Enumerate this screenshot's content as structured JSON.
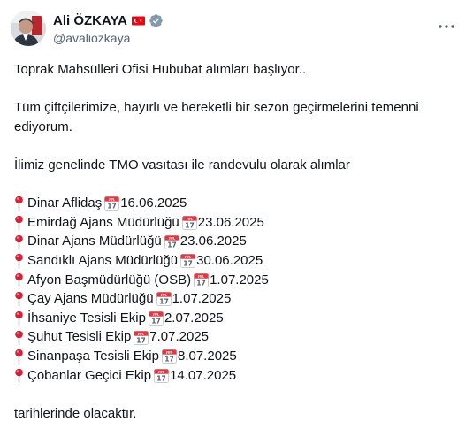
{
  "author": {
    "name": "Ali ÖZKAYA",
    "handle": "@avaliozkaya",
    "flag_icon": "turkey-flag-icon",
    "verified_icon": "verified-badge-icon",
    "verified_color": "#829aab"
  },
  "post": {
    "intro": "Toprak Mahsülleri Ofisi Hububat alımları başlıyor..",
    "wish": "Tüm çiftçilerimize, hayırlı ve bereketli bir sezon geçirmelerini temenni ediyorum.",
    "lead": "İlimiz genelinde TMO vasıtası ile randevulu olarak alımlar",
    "items": [
      {
        "place": "Dinar Aflidaş",
        "date": "16.06.2025"
      },
      {
        "place": "Emirdağ Ajans Müdürlüğü",
        "date": "23.06.2025"
      },
      {
        "place": "Dinar Ajans Müdürlüğü",
        "date": "23.06.2025"
      },
      {
        "place": "Sandıklı Ajans Müdürlüğü",
        "date": "30.06.2025"
      },
      {
        "place": "Afyon Başmüdürlüğü (OSB)",
        "date": "1.07.2025"
      },
      {
        "place": "Çay Ajans Müdürlüğü",
        "date": "1.07.2025"
      },
      {
        "place": "İhsaniye Tesisli Ekip",
        "date": "2.07.2025"
      },
      {
        "place": "Şuhut Tesisli Ekip",
        "date": "7.07.2025"
      },
      {
        "place": "Sinanpaşa Tesisli Ekip",
        "date": "8.07.2025"
      },
      {
        "place": "Çobanlar Geçici Ekip",
        "date": "14.07.2025"
      }
    ],
    "outro": "tarihlerinde olacaktır.",
    "item_icon": "round-pushpin-icon",
    "date_icon": "calendar-icon",
    "calendar_day": "17",
    "calendar_month": "JUL"
  },
  "colors": {
    "text": "#0f1419",
    "secondary": "#536471",
    "pin": "#d3233b",
    "flag_red": "#e30a17"
  }
}
